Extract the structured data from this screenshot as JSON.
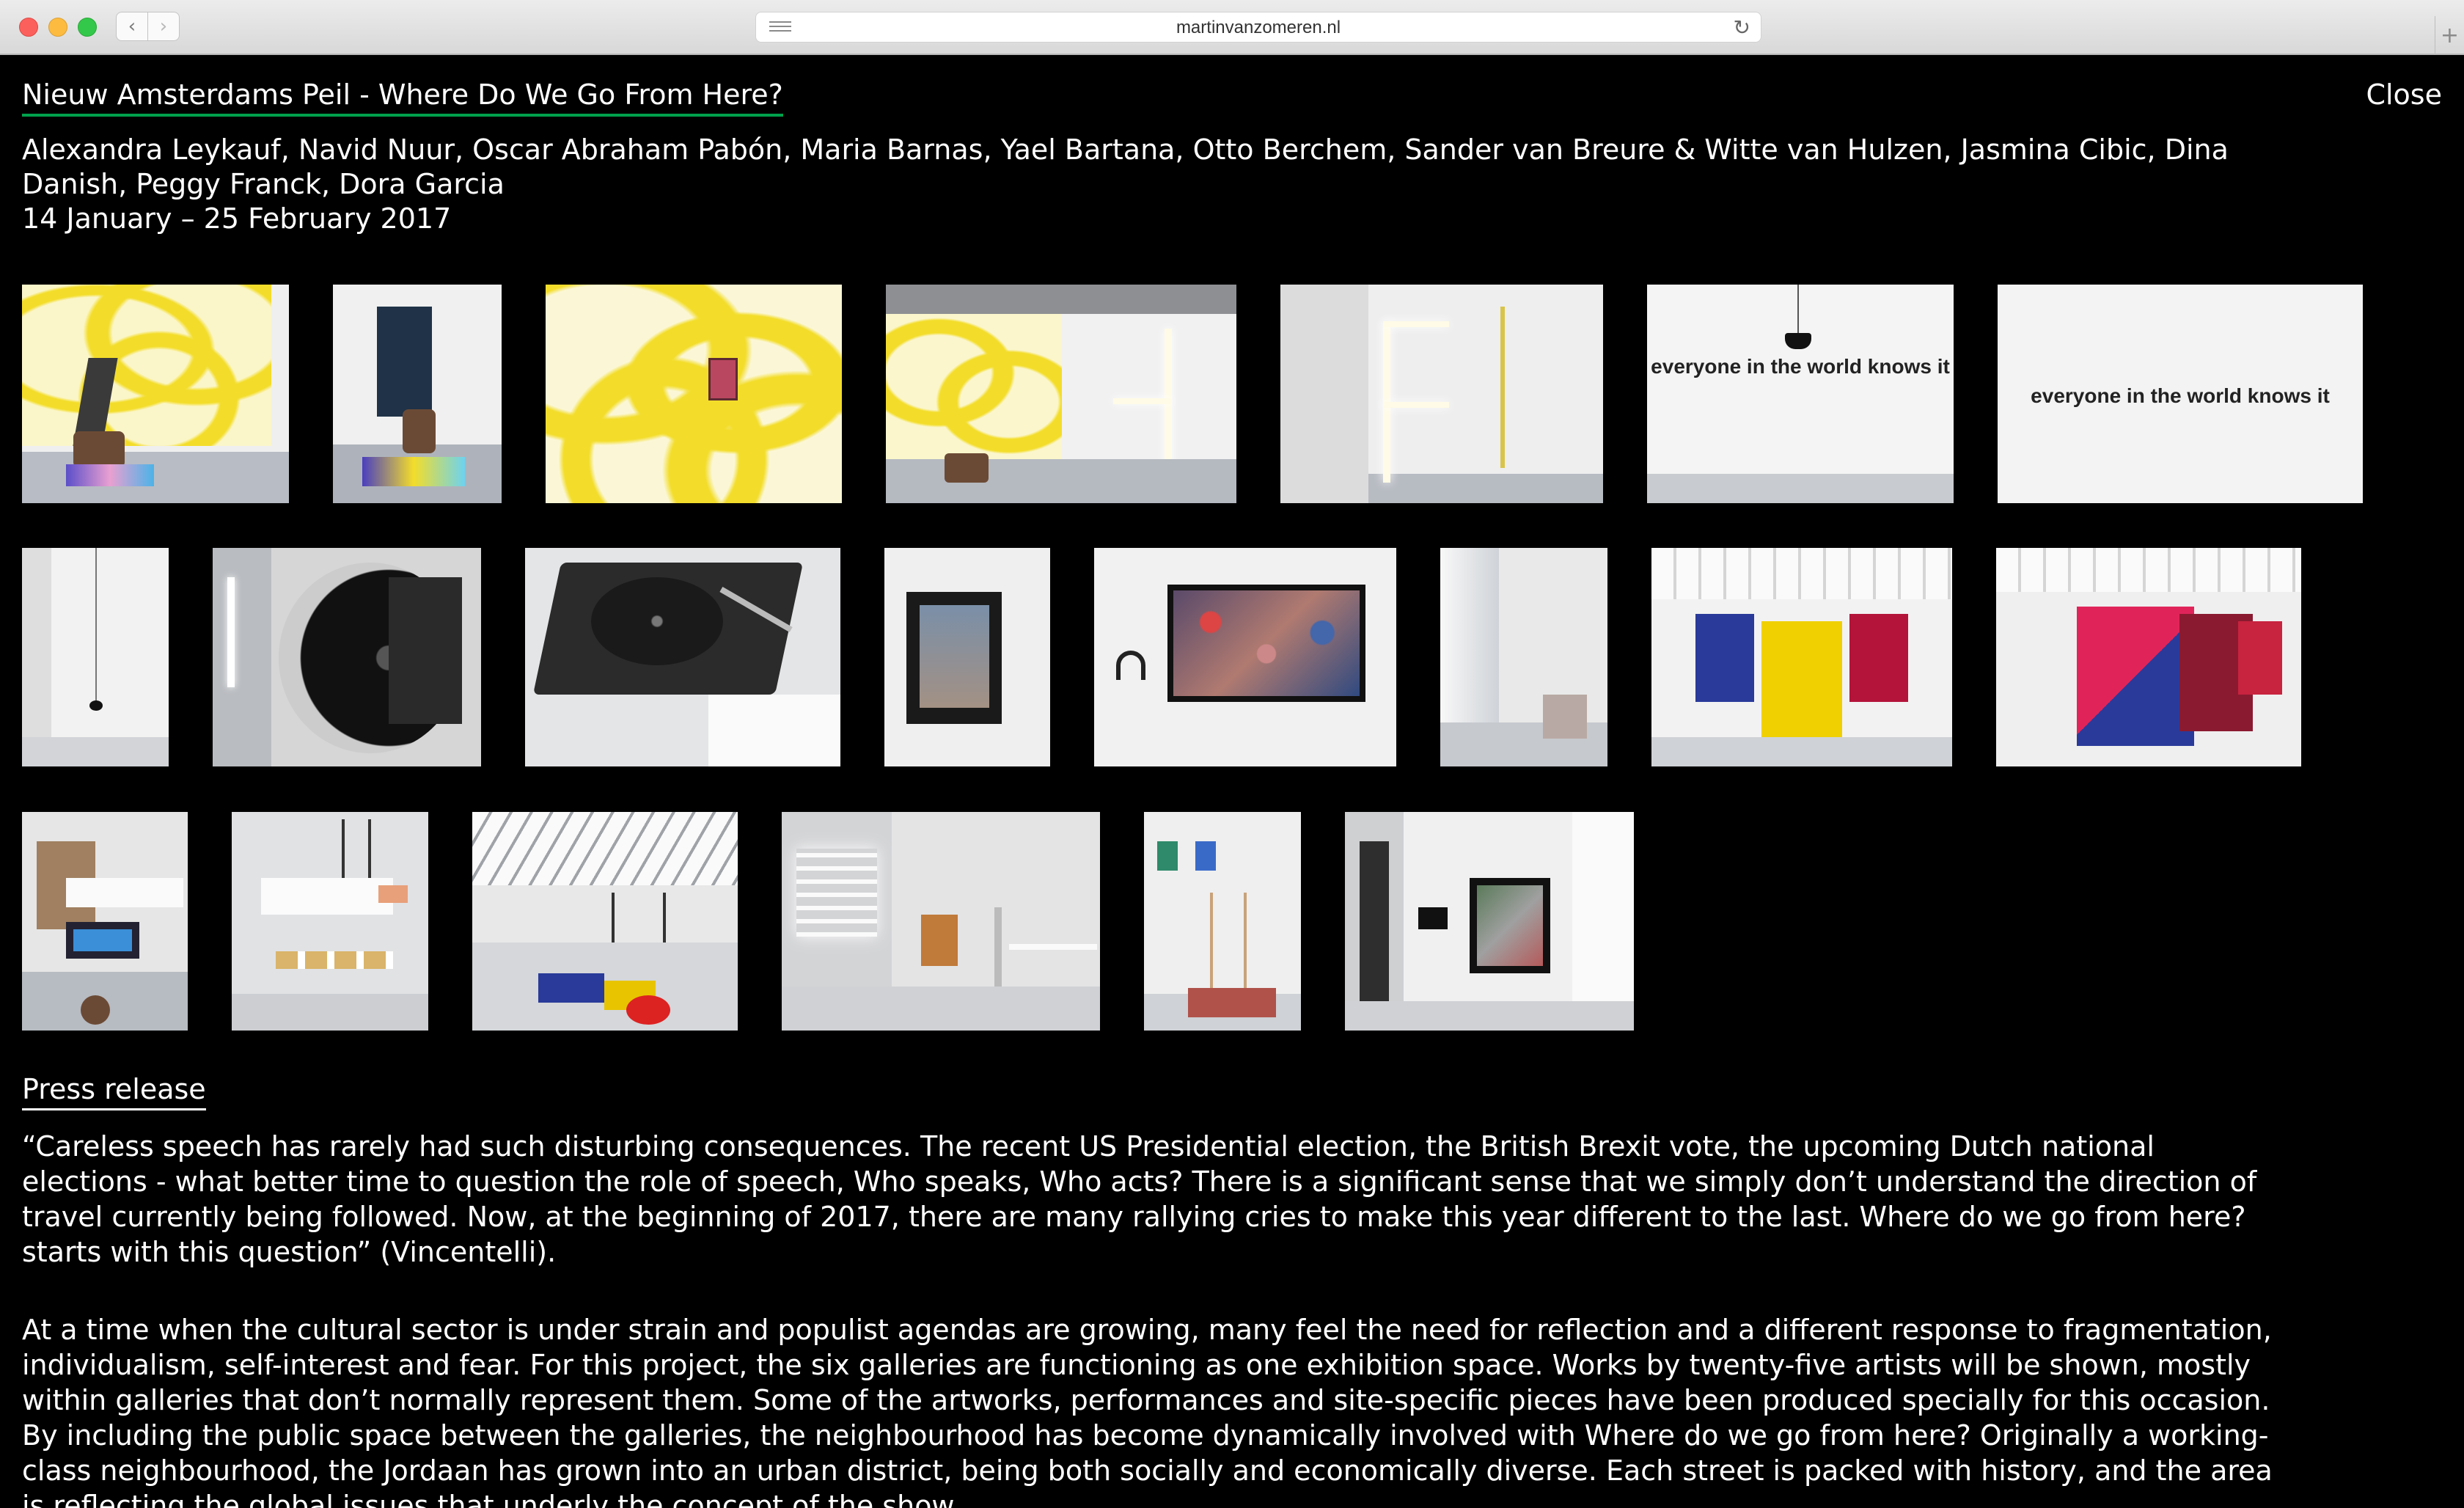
{
  "browser": {
    "url": "martinvanzomeren.nl",
    "back_glyph": "‹",
    "forward_glyph": "›",
    "reload_glyph": "↻",
    "new_tab_glyph": "+"
  },
  "exhibition": {
    "title": "Nieuw Amsterdams Peil - Where Do We Go From Here?",
    "close_label": "Close",
    "artists": "Alexandra Leykauf, Navid Nuur, Oscar Abraham Pabón, Maria Barnas, Yael Bartana, Otto Berchem, Sander van Breure & Witte van Hulzen, Jasmina Cibic, Dina Danish, Peggy Franck, Dora Garcia",
    "dates": "14 January – 25 February 2017",
    "accent_color": "#00a14b"
  },
  "gallery": {
    "thumb_06_text": "everyone in the world knows it",
    "thumb_07_text": "everyone in the world knows it"
  },
  "press_release": {
    "heading": "Press release",
    "paragraphs": [
      "“Careless speech has rarely had such disturbing consequences. The recent US Presidential election, the British Brexit vote, the upcoming Dutch national elections - what better time to question the role of speech, Who speaks, Who acts? There is a significant sense that we simply don’t understand the direction of travel currently being followed. Now, at the beginning of 2017, there are many rallying cries to make this year different to the last. Where do we go from here? starts with this question” (Vincentelli).",
      "At a time when the cultural sector is under strain and populist agendas are growing, many feel the need for reflection and a different response to fragmentation, individualism, self-interest and fear. For this project, the six galleries are functioning as one exhibition space. Works by twenty-five artists will be shown, mostly within galleries that don’t normally represent them. Some of the artworks, performances and site-specific pieces have been produced specially for this occasion. By including the public space between the galleries, the neighbourhood has become dynamically involved with Where do we go from here? Originally a working-class neighbourhood, the Jordaan has grown into an urban district, being both socially and economically diverse. Each street is packed with history, and the area is reflecting the global issues that underly the concept of the show."
    ]
  }
}
